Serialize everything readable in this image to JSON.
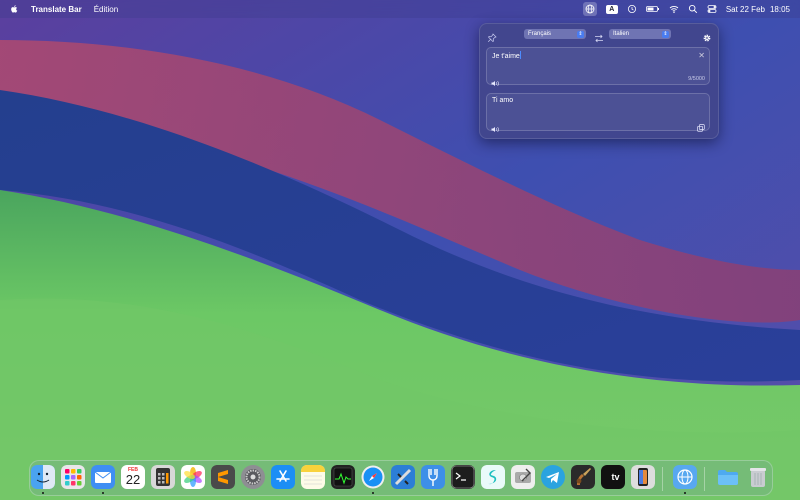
{
  "menubar": {
    "app_name": "Translate Bar",
    "menu_edit": "Édition",
    "date": "Sat 22 Feb",
    "time": "18:05",
    "input_source": "A",
    "icons": [
      "apple-icon",
      "globe-icon",
      "input-source-icon",
      "time-machine-icon",
      "battery-icon",
      "wifi-icon",
      "spotlight-icon",
      "control-center-icon"
    ]
  },
  "translator": {
    "source_lang": "Français",
    "target_lang": "Italien",
    "input_text": "Je t'aime",
    "char_count": "9/5000",
    "output_text": "Ti amo",
    "clear_symbol": "✕"
  },
  "dock": {
    "calendar_month": "FEB",
    "calendar_day": "22",
    "tv_label": "tv",
    "apps": [
      "finder",
      "launchpad",
      "mail",
      "calendar",
      "calculator",
      "photos",
      "sublime-text",
      "system-settings",
      "app-store",
      "notes",
      "activity-monitor",
      "safari",
      "xcode-instruments",
      "fork",
      "terminal",
      "surfshark",
      "disk-utility",
      "telegram",
      "instruments",
      "apple-tv",
      "iphone-mirroring",
      "translate-bar",
      "folder",
      "trash"
    ],
    "running": [
      "finder",
      "mail",
      "safari",
      "translate-bar"
    ]
  },
  "colors": {
    "accent": "#4a7cf0",
    "popover_bg": "#42468c"
  }
}
